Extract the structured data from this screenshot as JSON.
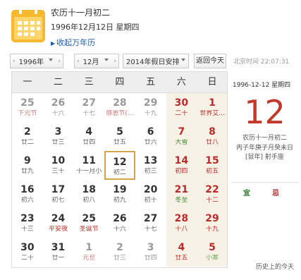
{
  "header": {
    "lunar_title": "农历十一月初二",
    "solar_title": "1996年12月12日 星期四",
    "collapse_label": "收起万年历"
  },
  "toolbar": {
    "prev_arrow": "‹",
    "next_arrow": "›",
    "year_value": "1996年",
    "month_value": "12月",
    "holiday_value": "2014年假日安排",
    "today_label": "返回今天",
    "beijing_time_label": "北京时间",
    "beijing_time": "22:07:31"
  },
  "weekdays": [
    "一",
    "二",
    "三",
    "四",
    "五",
    "六",
    "日"
  ],
  "weeks": [
    [
      {
        "d": "25",
        "l": "下元节",
        "other": true,
        "kind": "fest"
      },
      {
        "d": "26",
        "l": "十六",
        "other": true
      },
      {
        "d": "27",
        "l": "十七",
        "other": true
      },
      {
        "d": "28",
        "l": "感恩节(...",
        "other": true,
        "kind": "fest"
      },
      {
        "d": "29",
        "l": "十九",
        "other": true
      },
      {
        "d": "30",
        "l": "二十",
        "other": true,
        "red": true
      },
      {
        "d": "1",
        "l": "世界艾...",
        "red": true
      }
    ],
    [
      {
        "d": "2",
        "l": "廿二"
      },
      {
        "d": "3",
        "l": "廿三"
      },
      {
        "d": "4",
        "l": "廿四"
      },
      {
        "d": "5",
        "l": "廿五"
      },
      {
        "d": "6",
        "l": "廿六"
      },
      {
        "d": "7",
        "l": "大雪",
        "red": true,
        "kind": "term"
      },
      {
        "d": "8",
        "l": "廿八",
        "red": true
      }
    ],
    [
      {
        "d": "9",
        "l": "廿九"
      },
      {
        "d": "10",
        "l": "三十"
      },
      {
        "d": "11",
        "l": "十一月小"
      },
      {
        "d": "12",
        "l": "初二",
        "selected": true
      },
      {
        "d": "13",
        "l": "初三"
      },
      {
        "d": "14",
        "l": "初四",
        "red": true
      },
      {
        "d": "15",
        "l": "初五",
        "red": true
      }
    ],
    [
      {
        "d": "16",
        "l": "初六"
      },
      {
        "d": "17",
        "l": "初七"
      },
      {
        "d": "18",
        "l": "初八"
      },
      {
        "d": "19",
        "l": "初九"
      },
      {
        "d": "20",
        "l": "初十"
      },
      {
        "d": "21",
        "l": "冬至",
        "red": true,
        "kind": "term"
      },
      {
        "d": "22",
        "l": "十二",
        "red": true
      }
    ],
    [
      {
        "d": "23",
        "l": "十三"
      },
      {
        "d": "24",
        "l": "平安夜",
        "kind": "fest"
      },
      {
        "d": "25",
        "l": "圣诞节",
        "kind": "fest"
      },
      {
        "d": "26",
        "l": "十六"
      },
      {
        "d": "27",
        "l": "十七"
      },
      {
        "d": "28",
        "l": "十八",
        "red": true
      },
      {
        "d": "29",
        "l": "十九",
        "red": true
      }
    ],
    [
      {
        "d": "30",
        "l": "二十"
      },
      {
        "d": "31",
        "l": "廿一"
      },
      {
        "d": "1",
        "l": "元旦",
        "other": true,
        "kind": "fest"
      },
      {
        "d": "2",
        "l": "廿三",
        "other": true
      },
      {
        "d": "3",
        "l": "廿四",
        "other": true
      },
      {
        "d": "4",
        "l": "廿五",
        "other": true,
        "red": true
      },
      {
        "d": "5",
        "l": "小寒",
        "other": true,
        "red": true,
        "kind": "term"
      }
    ]
  ],
  "panel": {
    "date_line": "1996-12-12 星期四",
    "day_big": "12",
    "lunar_line": "农历十一月初二",
    "ganzhi_line": "丙子年庚子月癸未日",
    "zodiac_line": "[鼠年] 射手座",
    "yi_label": "宜",
    "ji_label": "忌",
    "history_label": "历史上的今天"
  },
  "colors": {
    "accent_red": "#c0392b",
    "weekend_col_bg": "#f8f2e6",
    "selected_border": "#d6a646",
    "link_blue": "#1a5aa6",
    "icon_yellow": "#f5b82e"
  }
}
